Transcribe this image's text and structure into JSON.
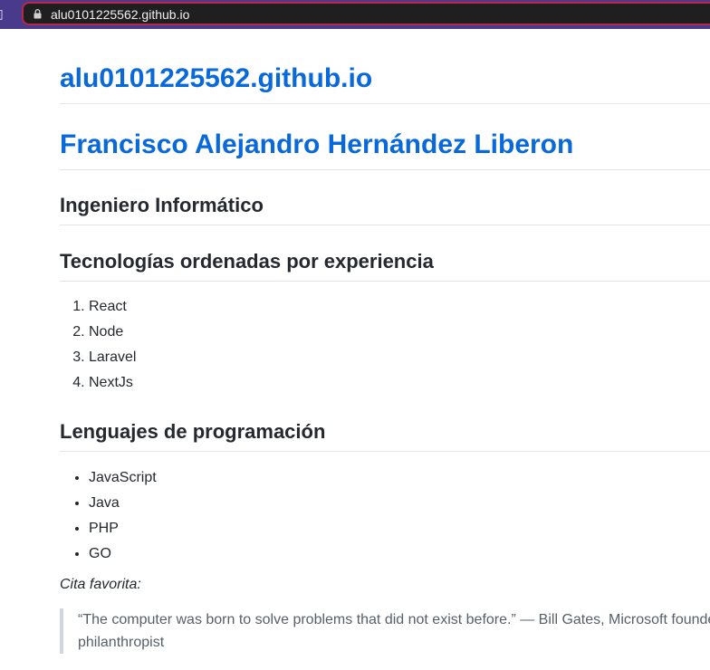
{
  "browser": {
    "url": "alu0101225562.github.io"
  },
  "page": {
    "site_title": "alu0101225562.github.io",
    "name": "Francisco Alejandro Hernández Liberon",
    "subtitle": "Ingeniero Informático",
    "tech_heading": "Tecnologías ordenadas por experiencia",
    "technologies": [
      "React",
      "Node",
      "Laravel",
      "NextJs"
    ],
    "lang_heading": "Lenguajes de programación",
    "languages": [
      "JavaScript",
      "Java",
      "PHP",
      "GO"
    ],
    "quote_intro": "Cita favorita:",
    "quote": "“The computer was born to solve problems that did not exist before.” — Bill Gates, Microsoft founder, philanthropist"
  },
  "colors": {
    "link_blue": "#0969da",
    "text": "#24292f",
    "quote_text": "#57606a",
    "frame_purple": "#4a3a8c",
    "address_border": "#b6294b"
  }
}
